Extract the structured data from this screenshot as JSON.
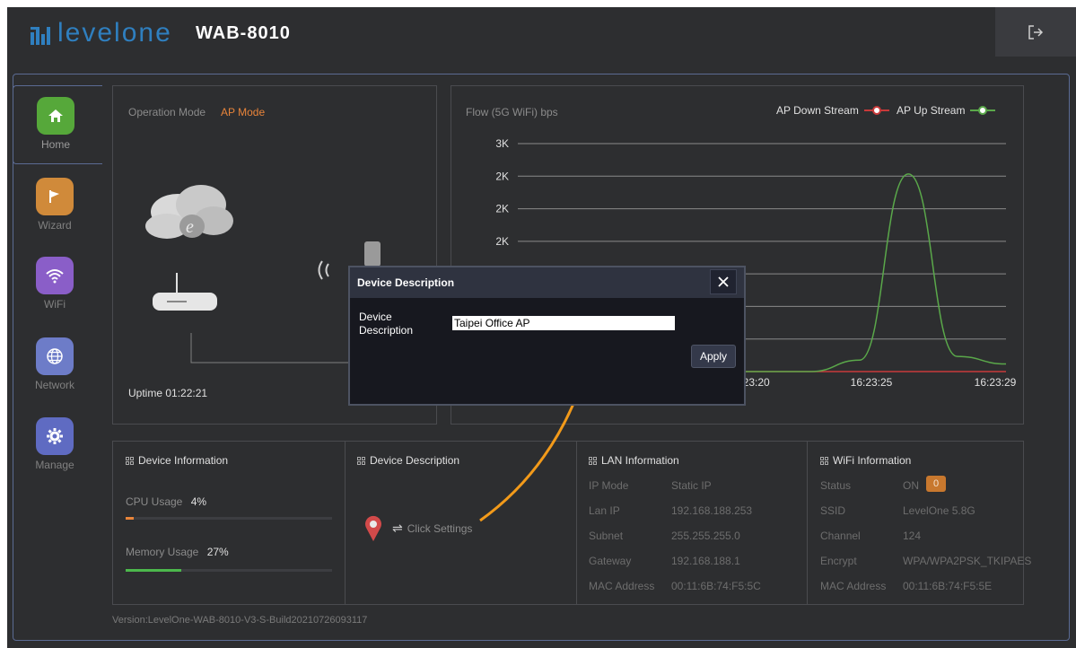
{
  "header": {
    "brand": "levelone",
    "model": "WAB-8010",
    "logout_icon": "logout-icon"
  },
  "sidebar": {
    "items": [
      {
        "label": "Home",
        "icon": "home-icon",
        "color": "#56a83a",
        "active": true
      },
      {
        "label": "Wizard",
        "icon": "flag-icon",
        "color": "#d08a3a",
        "active": false
      },
      {
        "label": "WiFi",
        "icon": "wifi-icon",
        "color": "#8a5ec8",
        "active": false
      },
      {
        "label": "Network",
        "icon": "globe-icon",
        "color": "#6d7cc8",
        "active": false
      },
      {
        "label": "Manage",
        "icon": "gear-icon",
        "color": "#5f6bc2",
        "active": false
      }
    ]
  },
  "mode_panel": {
    "label": "Operation Mode",
    "value": "AP Mode",
    "uptime": "Uptime 01:22:21"
  },
  "flow_panel": {
    "title": "Flow (5G WiFi) bps",
    "legend_down": "AP Down Stream",
    "legend_up": "AP Up Stream"
  },
  "chart_data": {
    "type": "line",
    "title": "Flow (5G WiFi) bps",
    "y_tick_labels": [
      "3K",
      "2K",
      "2K",
      "2K"
    ],
    "x_tick_labels": [
      ":23:20",
      "16:23:25",
      "16:23:29"
    ],
    "series": [
      {
        "name": "AP Down Stream",
        "color": "#c83a3a",
        "values": [
          0,
          0,
          0,
          0,
          0,
          0,
          0,
          0,
          0,
          0,
          0
        ]
      },
      {
        "name": "AP Up Stream",
        "color": "#5aa84a",
        "values": [
          0,
          0,
          0,
          0,
          0,
          0,
          0,
          0.15,
          2.6,
          0.2,
          0.1
        ]
      }
    ],
    "ylim": [
      0,
      3
    ]
  },
  "bottom": {
    "device_info": {
      "title": "Device Information",
      "cpu_label": "CPU Usage",
      "cpu_value": "4%",
      "cpu_fraction": 0.04,
      "mem_label": "Memory Usage",
      "mem_value": "27%",
      "mem_fraction": 0.27
    },
    "device_desc": {
      "title": "Device Description",
      "click_settings": "Click Settings"
    },
    "lan": {
      "title": "LAN Information",
      "rows": [
        {
          "k": "IP Mode",
          "v": "Static IP"
        },
        {
          "k": "Lan IP",
          "v": "192.168.188.253"
        },
        {
          "k": "Subnet",
          "v": "255.255.255.0"
        },
        {
          "k": "Gateway",
          "v": "192.168.188.1"
        },
        {
          "k": "MAC Address",
          "v": "00:11:6B:74:F5:5C"
        }
      ]
    },
    "wifi": {
      "title": "WiFi Information",
      "status_label": "Status",
      "status_value": "ON",
      "status_badge": "0",
      "rows": [
        {
          "k": "SSID",
          "v": "LevelOne 5.8G"
        },
        {
          "k": "Channel",
          "v": "124"
        },
        {
          "k": "Encrypt",
          "v": "WPA/WPA2PSK_TKIPAES"
        },
        {
          "k": "MAC Address",
          "v": "00:11:6B:74:F5:5E"
        }
      ]
    },
    "version": "Version:LevelOne-WAB-8010-V3-S-Build20210726093117"
  },
  "modal": {
    "title": "Device Description",
    "field_label": "Device Description",
    "field_value": "Taipei Office AP",
    "apply_label": "Apply"
  },
  "colors": {
    "accent_orange": "#e8843a",
    "brand_blue": "#2f7fbf",
    "annotation_arrow": "#f29a1a"
  }
}
